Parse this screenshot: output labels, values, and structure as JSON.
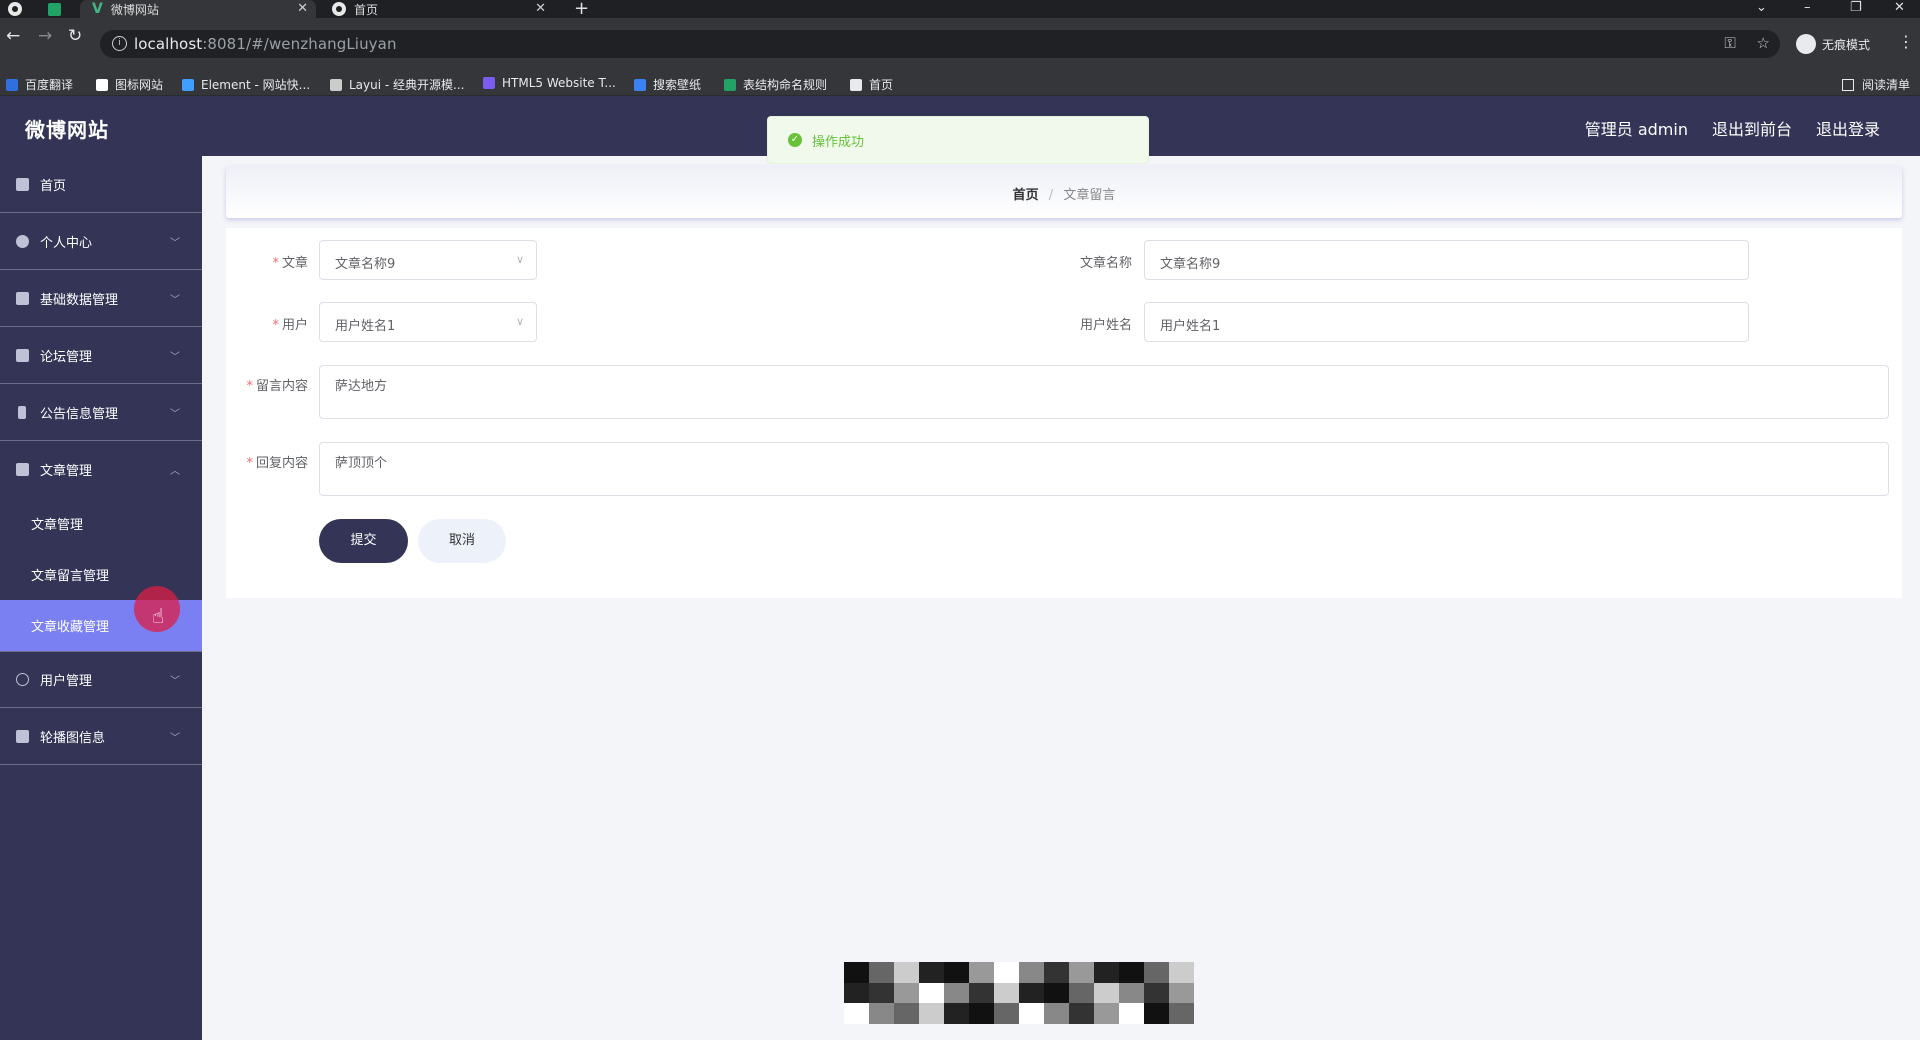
{
  "browser": {
    "tabs": [
      {
        "title": ""
      },
      {
        "title": ""
      },
      {
        "title": "微博网站"
      },
      {
        "title": "首页"
      }
    ],
    "url_host": "localhost",
    "url_path": ":8081/#/wenzhangLiuyan",
    "profile_label": "无痕模式",
    "bookmarks": [
      {
        "label": "百度翻译",
        "color": "#2f6fe0"
      },
      {
        "label": "图标网站",
        "color": "#ffffff"
      },
      {
        "label": "Element - 网站快...",
        "color": "#409eff"
      },
      {
        "label": "Layui - 经典开源模...",
        "color": "#cccccc"
      },
      {
        "label": "HTML5 Website T...",
        "color": "#7b5cf0"
      },
      {
        "label": "搜索壁纸",
        "color": "#3b82f6"
      },
      {
        "label": "表结构命名规则",
        "color": "#21a366"
      },
      {
        "label": "首页",
        "color": "#e8eaed"
      }
    ],
    "reading_list": "阅读清单"
  },
  "app": {
    "brand": "微博网站",
    "header_links": [
      "管理员 admin",
      "退出到前台",
      "退出登录"
    ]
  },
  "sidebar": {
    "items": [
      {
        "label": "首页",
        "icon": "home-icon"
      },
      {
        "label": "个人中心",
        "icon": "user-icon"
      },
      {
        "label": "基础数据管理",
        "icon": "chat-icon"
      },
      {
        "label": "论坛管理",
        "icon": "clipboard-icon"
      },
      {
        "label": "公告信息管理",
        "icon": "phone-icon"
      },
      {
        "label": "文章管理",
        "icon": "chart-icon"
      },
      {
        "label": "用户管理",
        "icon": "clock-icon"
      },
      {
        "label": "轮播图信息",
        "icon": "clipboard-check-icon"
      }
    ],
    "sub_items": [
      "文章管理",
      "文章留言管理",
      "文章收藏管理"
    ]
  },
  "breadcrumb": {
    "home": "首页",
    "sep": "/",
    "current": "文章留言"
  },
  "toast": {
    "text": "操作成功"
  },
  "form": {
    "article_label": "文章",
    "article_value": "文章名称9",
    "article_name_label": "文章名称",
    "article_name_value": "文章名称9",
    "user_label": "用户",
    "user_value": "用户姓名1",
    "user_name_label": "用户姓名",
    "user_name_value": "用户姓名1",
    "comment_label": "留言内容",
    "comment_value": "萨达地方",
    "reply_label": "回复内容",
    "reply_value": "萨顶顶个",
    "submit": "提交",
    "cancel": "取消",
    "required_mark": "*"
  },
  "colors": {
    "header_bg": "#333456",
    "active_menu": "#7a80f2",
    "toast_green": "#67c23a",
    "required": "#f56c6c"
  }
}
